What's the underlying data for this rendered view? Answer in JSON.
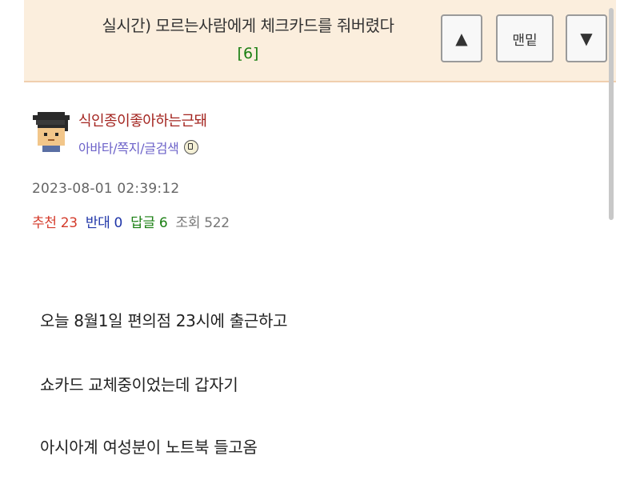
{
  "header": {
    "title": "실시간) 모르는사람에게 체크카드를 줘버렸다",
    "comment_count": "[6]",
    "buttons": {
      "up_icon": "▲",
      "bottom_label": "맨밑",
      "down_icon": "▼"
    }
  },
  "author": {
    "avatar_icon": "graduate-cap-pixel-avatar-icon",
    "name": "식인종이좋아하는근돼",
    "links": "아바타/쪽지/글검색",
    "badge_icon": "level-badge-icon"
  },
  "post": {
    "timestamp": "2023-08-01 02:39:12",
    "stats": {
      "recommend_label": "추천",
      "recommend_value": "23",
      "oppose_label": "반대",
      "oppose_value": "0",
      "replies_label": "답글",
      "replies_value": "6",
      "views_label": "조회",
      "views_value": "522"
    },
    "body": [
      "오늘 8월1일 편의점 23시에 출근하고",
      "쇼카드 교체중이었는데 갑자기",
      "아시아계 여성분이 노트북 들고옴"
    ]
  },
  "colors": {
    "header_bg": "#fbeedd",
    "author_name": "#a3241f",
    "author_links": "#6d63c9",
    "recommend": "#d43b2b",
    "oppose": "#1f35a8",
    "replies": "#1a7f12"
  }
}
